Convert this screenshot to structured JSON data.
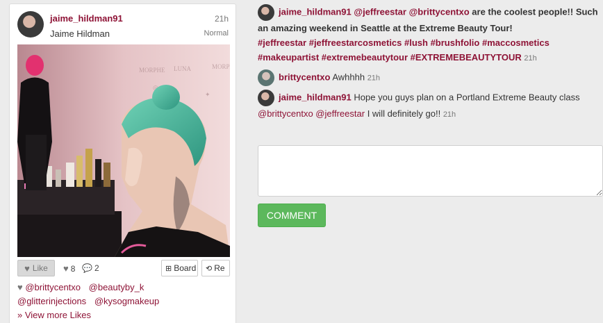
{
  "post": {
    "username": "jaime_hildman91",
    "full_name": "Jaime Hildman",
    "time": "21h",
    "filter": "Normal",
    "photo_alt_icon": "post-photo",
    "like_label": "Like",
    "likes_count": "8",
    "comments_count": "2",
    "board_label": "Board",
    "repost_label": "Re",
    "likers": [
      "@brittycentxo",
      "@beautyby_k",
      "@glitterinjections",
      "@kysogmakeup"
    ],
    "view_more_label": "» View more Likes"
  },
  "comments": [
    {
      "author": "jaime_hildman91",
      "text_parts": [
        "@jeffreestar",
        "@brittycentxo",
        "are the coolest people!! Such an amazing weekend in Seattle at the Extreme Beauty Tour!"
      ],
      "hashtags": "#jeffreestar #jeffreestarcosmetics #lush #brushfolio #maccosmetics #makeupartist #extremebeautytour #EXTREMEBEAUTYTOUR",
      "time": "21h"
    },
    {
      "author": "brittycentxo",
      "text": "Awhhhh",
      "time": "21h"
    },
    {
      "author": "jaime_hildman91",
      "text_a": "Hope you guys plan on a Portland Extreme Beauty class",
      "mention_a": "@brittycentxo",
      "mention_b": "@jeffreestar",
      "text_b": "I will definitely go!!",
      "time": "21h"
    }
  ],
  "comment_input": {
    "placeholder": ""
  },
  "comment_button": "COMMENT",
  "colors": {
    "link": "#8e1336",
    "button": "#5cb85c",
    "background": "#ececec"
  }
}
